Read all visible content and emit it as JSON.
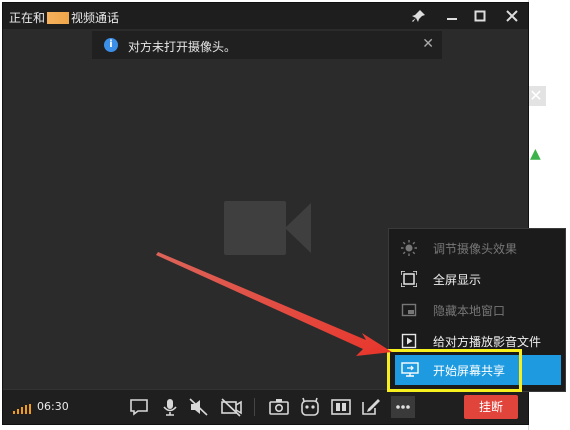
{
  "window": {
    "title_prefix": "正在和",
    "title_suffix": "视频通话"
  },
  "notice": {
    "icon": "info-icon",
    "text": "对方未打开摄像头。"
  },
  "call": {
    "time": "06:30",
    "hangup_label": "挂断"
  },
  "menu": {
    "items": [
      {
        "label": "调节摄像头效果",
        "icon": "brightness-icon",
        "state": "disabled"
      },
      {
        "label": "全屏显示",
        "icon": "fullscreen-icon",
        "state": "enabled"
      },
      {
        "label": "隐藏本地窗口",
        "icon": "hide-window-icon",
        "state": "disabled"
      },
      {
        "label": "给对方播放影音文件",
        "icon": "play-file-icon",
        "state": "enabled"
      },
      {
        "label": "开始屏幕共享",
        "icon": "screen-share-icon",
        "state": "active"
      }
    ]
  },
  "colors": {
    "accent": "#1e9be0",
    "hangup": "#e0443b",
    "highlight": "#f7ef1e",
    "annotation_arrow": "#e8352b"
  }
}
